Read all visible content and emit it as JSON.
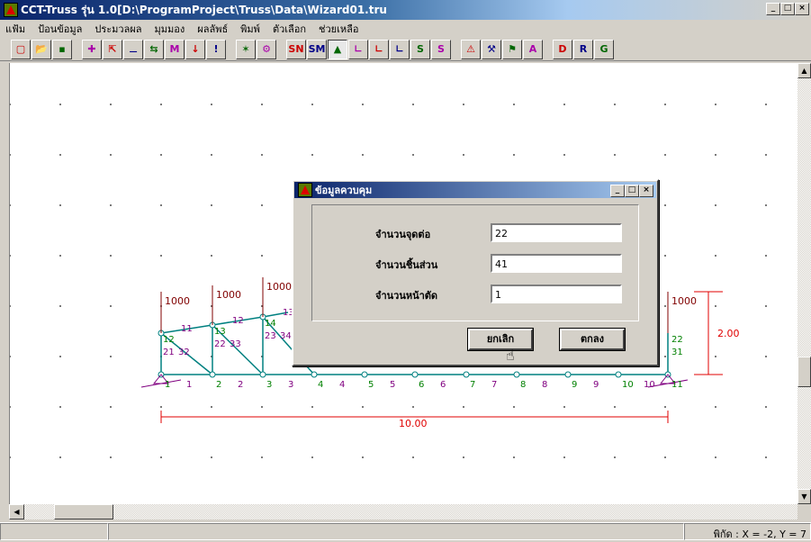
{
  "window": {
    "title": "CCT-Truss รุ่น 1.0[D:\\ProgramProject\\Truss\\Data\\Wizard01.tru",
    "min": "_",
    "max": "□",
    "close": "×"
  },
  "menu": [
    "แฟ้ม",
    "ป้อนข้อมูล",
    "ประมวลผล",
    "มุมมอง",
    "ผลลัพธ์",
    "พิมพ์",
    "ตัวเลือก",
    "ช่วยเหลือ"
  ],
  "toolbar": [
    {
      "name": "new-icon",
      "g": "▢"
    },
    {
      "name": "open-icon",
      "g": "📂"
    },
    {
      "name": "save-icon",
      "g": "▪"
    },
    {
      "name": "node-icon",
      "g": "✚"
    },
    {
      "name": "member-icon",
      "g": "⇱"
    },
    {
      "name": "support-icon",
      "g": "⚊"
    },
    {
      "name": "section-icon",
      "g": "⇆"
    },
    {
      "name": "material-icon",
      "g": "M"
    },
    {
      "name": "load-icon",
      "g": "↓"
    },
    {
      "name": "warning-icon",
      "g": "!"
    },
    {
      "name": "truss-icon",
      "g": "✶"
    },
    {
      "name": "truss2-icon",
      "g": "⚙"
    },
    {
      "name": "result-sn-icon",
      "g": "SN"
    },
    {
      "name": "result-sm-icon",
      "g": "SM"
    },
    {
      "name": "shape-icon",
      "g": "▲"
    },
    {
      "name": "draw1-icon",
      "g": "∟"
    },
    {
      "name": "draw2-icon",
      "g": "∟"
    },
    {
      "name": "draw3-icon",
      "g": "∟"
    },
    {
      "name": "scale1-icon",
      "g": "S"
    },
    {
      "name": "scale2-icon",
      "g": "S"
    },
    {
      "name": "view1-icon",
      "g": "⚠"
    },
    {
      "name": "view2-icon",
      "g": "⚒"
    },
    {
      "name": "view3-icon",
      "g": "⚑"
    },
    {
      "name": "area-icon",
      "g": "A"
    },
    {
      "name": "report-d-icon",
      "g": "D"
    },
    {
      "name": "report-r-icon",
      "g": "R"
    },
    {
      "name": "report-g-icon",
      "g": "G"
    }
  ],
  "colors": {
    "member": "#008080",
    "dim": "#e00000",
    "node_label": "#800080",
    "load": "#800000",
    "green": "#008000"
  },
  "drawing": {
    "loads": [
      "1000",
      "1000",
      "1000",
      "1000"
    ],
    "top_labels": [
      "11",
      "12",
      "13"
    ],
    "left_labels": [
      "12",
      "21",
      "32",
      "13",
      "22",
      "33",
      "14",
      "23",
      "34"
    ],
    "bottom_labels": [
      "1",
      "1",
      "2",
      "2",
      "3",
      "3",
      "4",
      "4",
      "5",
      "5",
      "6",
      "6",
      "7",
      "7",
      "8",
      "8",
      "9",
      "9",
      "10",
      "10",
      "11"
    ],
    "right_labels": [
      "22",
      "31"
    ],
    "height_dim": "2.00",
    "span_dim": "10.00"
  },
  "dialog": {
    "title": "ข้อมูลควบคุม",
    "fields": [
      {
        "label": "จำนวนจุดต่อ",
        "value": "22"
      },
      {
        "label": "จำนวนชิ้นส่วน",
        "value": "41"
      },
      {
        "label": "จำนวนหน้าตัด",
        "value": "1"
      }
    ],
    "cancel": "ยกเลิก",
    "ok": "ตกลง"
  },
  "status": {
    "coords": "พิกัด : X = -2, Y = 7"
  }
}
